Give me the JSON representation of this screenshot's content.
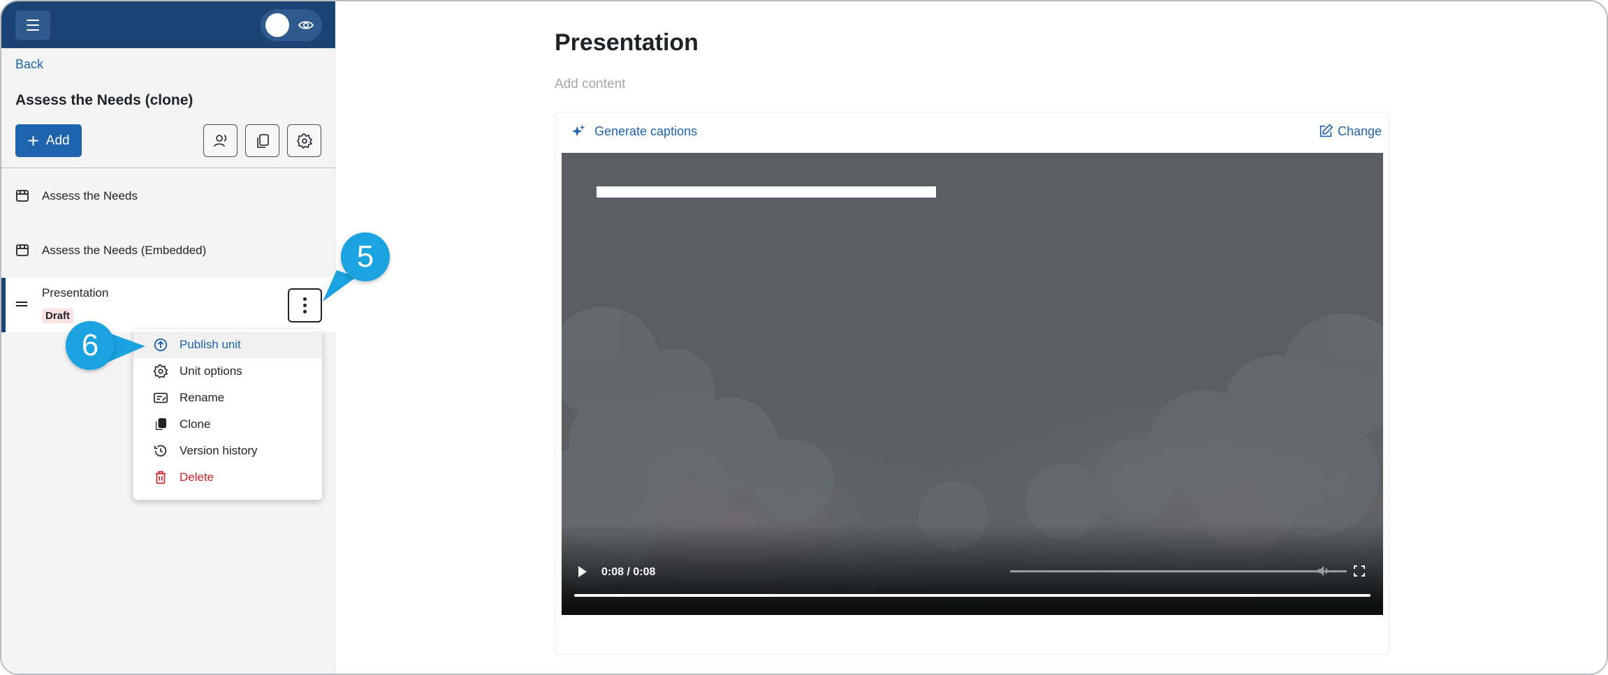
{
  "sidebar": {
    "back_label": "Back",
    "course_title": "Assess the Needs (clone)",
    "add_label": "Add",
    "units": [
      {
        "label": "Assess the Needs"
      },
      {
        "label": "Assess the Needs (Embedded)"
      }
    ],
    "active_unit": {
      "label": "Presentation",
      "status": "Draft"
    }
  },
  "context_menu": {
    "items": [
      {
        "label": "Publish unit",
        "icon": "publish-icon"
      },
      {
        "label": "Unit options",
        "icon": "gear-icon"
      },
      {
        "label": "Rename",
        "icon": "rename-icon"
      },
      {
        "label": "Clone",
        "icon": "clone-icon"
      },
      {
        "label": "Version history",
        "icon": "history-icon"
      },
      {
        "label": "Delete",
        "icon": "trash-icon"
      }
    ]
  },
  "callouts": {
    "first": "5",
    "second": "6"
  },
  "main": {
    "title": "Presentation",
    "add_content_placeholder": "Add content",
    "generate_captions_label": "Generate captions",
    "change_label": "Change",
    "video": {
      "time": "0:08 / 0:08",
      "progress": 1.0
    }
  },
  "colors": {
    "brand": "#1b4374",
    "accent": "#1e63ad",
    "callout": "#1aa3e0",
    "danger": "#d0212b"
  }
}
